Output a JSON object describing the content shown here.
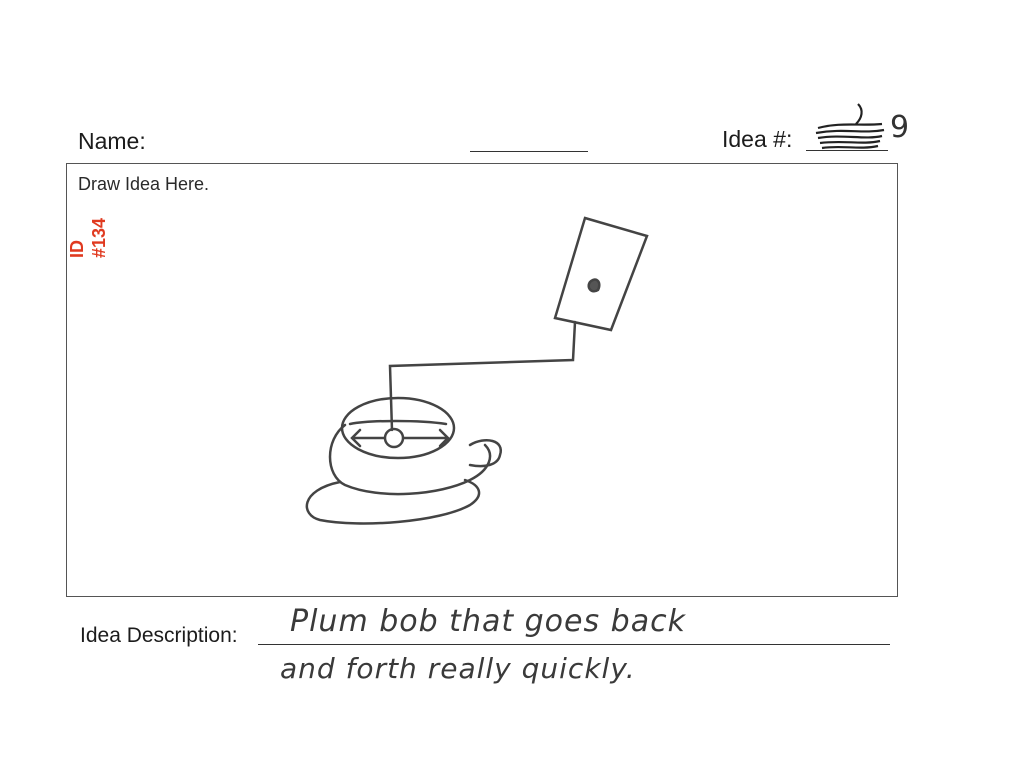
{
  "form": {
    "name_label": "Name:",
    "idea_label": "Idea #:",
    "draw_label_visible": "Draw Idea Here.",
    "description_label": "Idea Description:"
  },
  "handwriting": {
    "idea_number": "9",
    "description_line1": "Plum bob that goes back",
    "description_line2": "and forth really quickly."
  },
  "stamp": {
    "line1": "ID",
    "line2": "#134",
    "color": "#e03a20"
  },
  "icons": {
    "sketch": "plumb-bob-sketch",
    "redaction": "scribble-redaction"
  }
}
